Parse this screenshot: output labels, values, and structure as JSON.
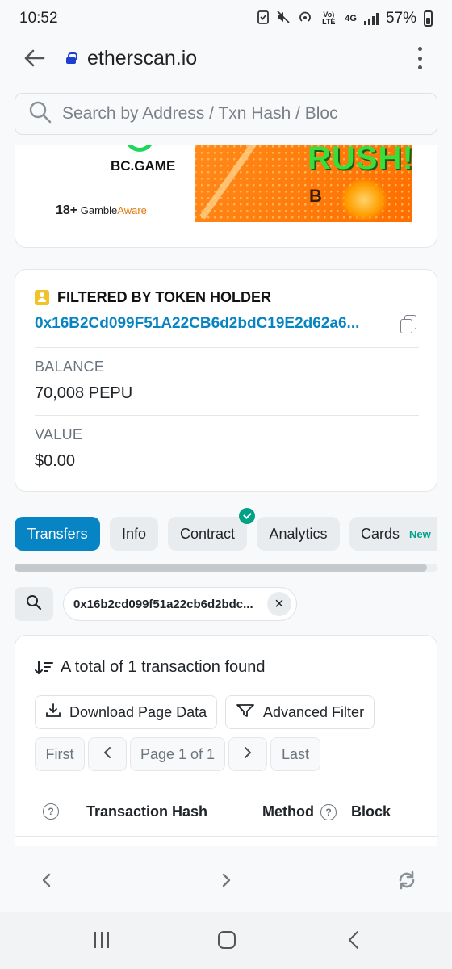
{
  "status_bar": {
    "time": "10:52",
    "network_label": "Vo) LTE",
    "signal_label": "4G",
    "battery": "57%"
  },
  "browser": {
    "url": "etherscan.io",
    "search_placeholder": "Search by Address / Txn Hash / Bloc"
  },
  "ad": {
    "brand": "BC.GAME",
    "age_notice": "18+",
    "gamble": "Gamble",
    "aware": "Aware",
    "headline": "RUSH!",
    "letter": "B"
  },
  "holder": {
    "title": "FILTERED BY TOKEN HOLDER",
    "address": "0x16B2Cd099F51A22CB6d2bdC19E2d62a6...",
    "balance_label": "BALANCE",
    "balance_value": "70,008 PEPU",
    "value_label": "VALUE",
    "value_value": "$0.00"
  },
  "tabs": [
    {
      "label": "Transfers",
      "active": true
    },
    {
      "label": "Info",
      "active": false
    },
    {
      "label": "Contract",
      "active": false,
      "verified": true
    },
    {
      "label": "Analytics",
      "active": false
    },
    {
      "label": "Cards",
      "active": false,
      "badge": "New"
    }
  ],
  "filter": {
    "chip_text": "0x16b2cd099f51a22cb6d2bdc..."
  },
  "transactions": {
    "summary": "A total of 1 transaction found",
    "download_label": "Download Page Data",
    "advanced_filter_label": "Advanced Filter",
    "pagination": {
      "first": "First",
      "page_label": "Page 1 of 1",
      "last": "Last"
    },
    "columns": [
      "Transaction Hash",
      "Method",
      "Block"
    ]
  },
  "colors": {
    "accent": "#0784c3",
    "verified": "#00a186",
    "background": "#f8f9fa"
  }
}
